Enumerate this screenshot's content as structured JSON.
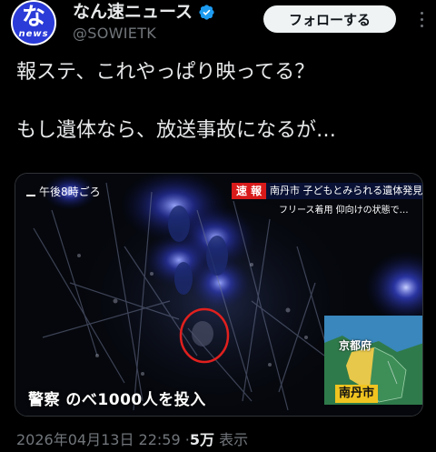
{
  "account": {
    "display_name": "なん速ニュース",
    "handle": "@SOWIETK",
    "avatar_text": "な",
    "avatar_subtext": "news",
    "verified": true
  },
  "actions": {
    "follow_label": "フォローする"
  },
  "tweet": {
    "lines": [
      "報ステ、これやっぱり映ってる？",
      "もし遺体なら、放送事故になるが…"
    ]
  },
  "media": {
    "time_caption": "午後8時ごろ",
    "breaking_label": "速 報",
    "headline": "南丹市 子どもとみられる遺体発見",
    "subline": "フリース着用 仰向けの状態で…",
    "bottom_caption": "警察 のべ1000人を投入",
    "map_prefecture": "京都府",
    "map_city": "南丹市"
  },
  "meta": {
    "date": "2026年04月13日 22:59",
    "separator": "·",
    "views_count": "5万",
    "views_label": "表示"
  },
  "colors": {
    "background": "#000000",
    "text": "#e7e9ea",
    "secondary_text": "#71767b",
    "verified": "#1d9bf0",
    "breaking_red": "#d91a1a",
    "city_label": "#f0c420"
  }
}
